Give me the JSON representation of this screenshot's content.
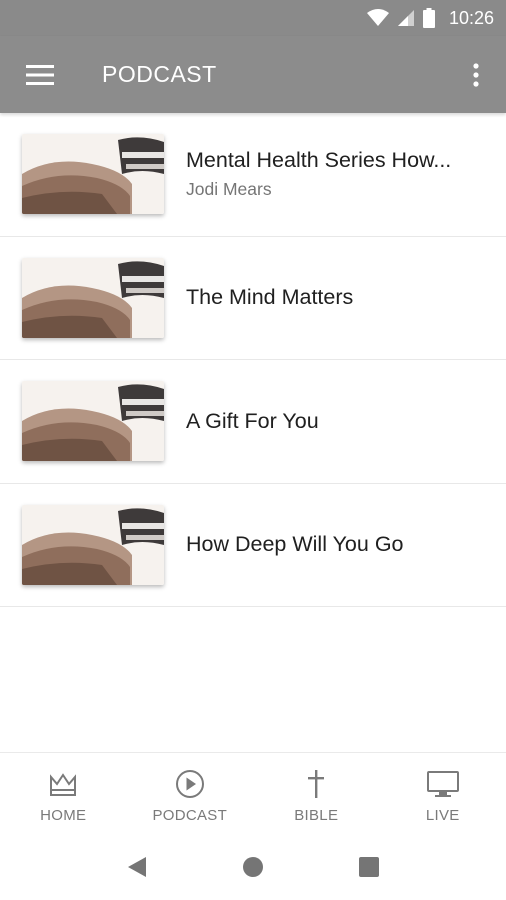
{
  "status_bar": {
    "time": "10:26"
  },
  "app_bar": {
    "title": "PODCAST"
  },
  "podcasts": [
    {
      "title": "Mental Health Series How...",
      "subtitle": "Jodi Mears"
    },
    {
      "title": "The Mind Matters",
      "subtitle": ""
    },
    {
      "title": "A Gift For You",
      "subtitle": ""
    },
    {
      "title": "How Deep Will You Go",
      "subtitle": ""
    }
  ],
  "bottom_nav": {
    "items": [
      {
        "label": "HOME",
        "icon": "crown-icon"
      },
      {
        "label": "PODCAST",
        "icon": "play-circle-icon"
      },
      {
        "label": "BIBLE",
        "icon": "cross-icon"
      },
      {
        "label": "LIVE",
        "icon": "tv-icon"
      }
    ]
  },
  "colors": {
    "app_bar": "#8c8c8c",
    "nav_icon": "#7a7a7a",
    "title_text": "#202020"
  }
}
